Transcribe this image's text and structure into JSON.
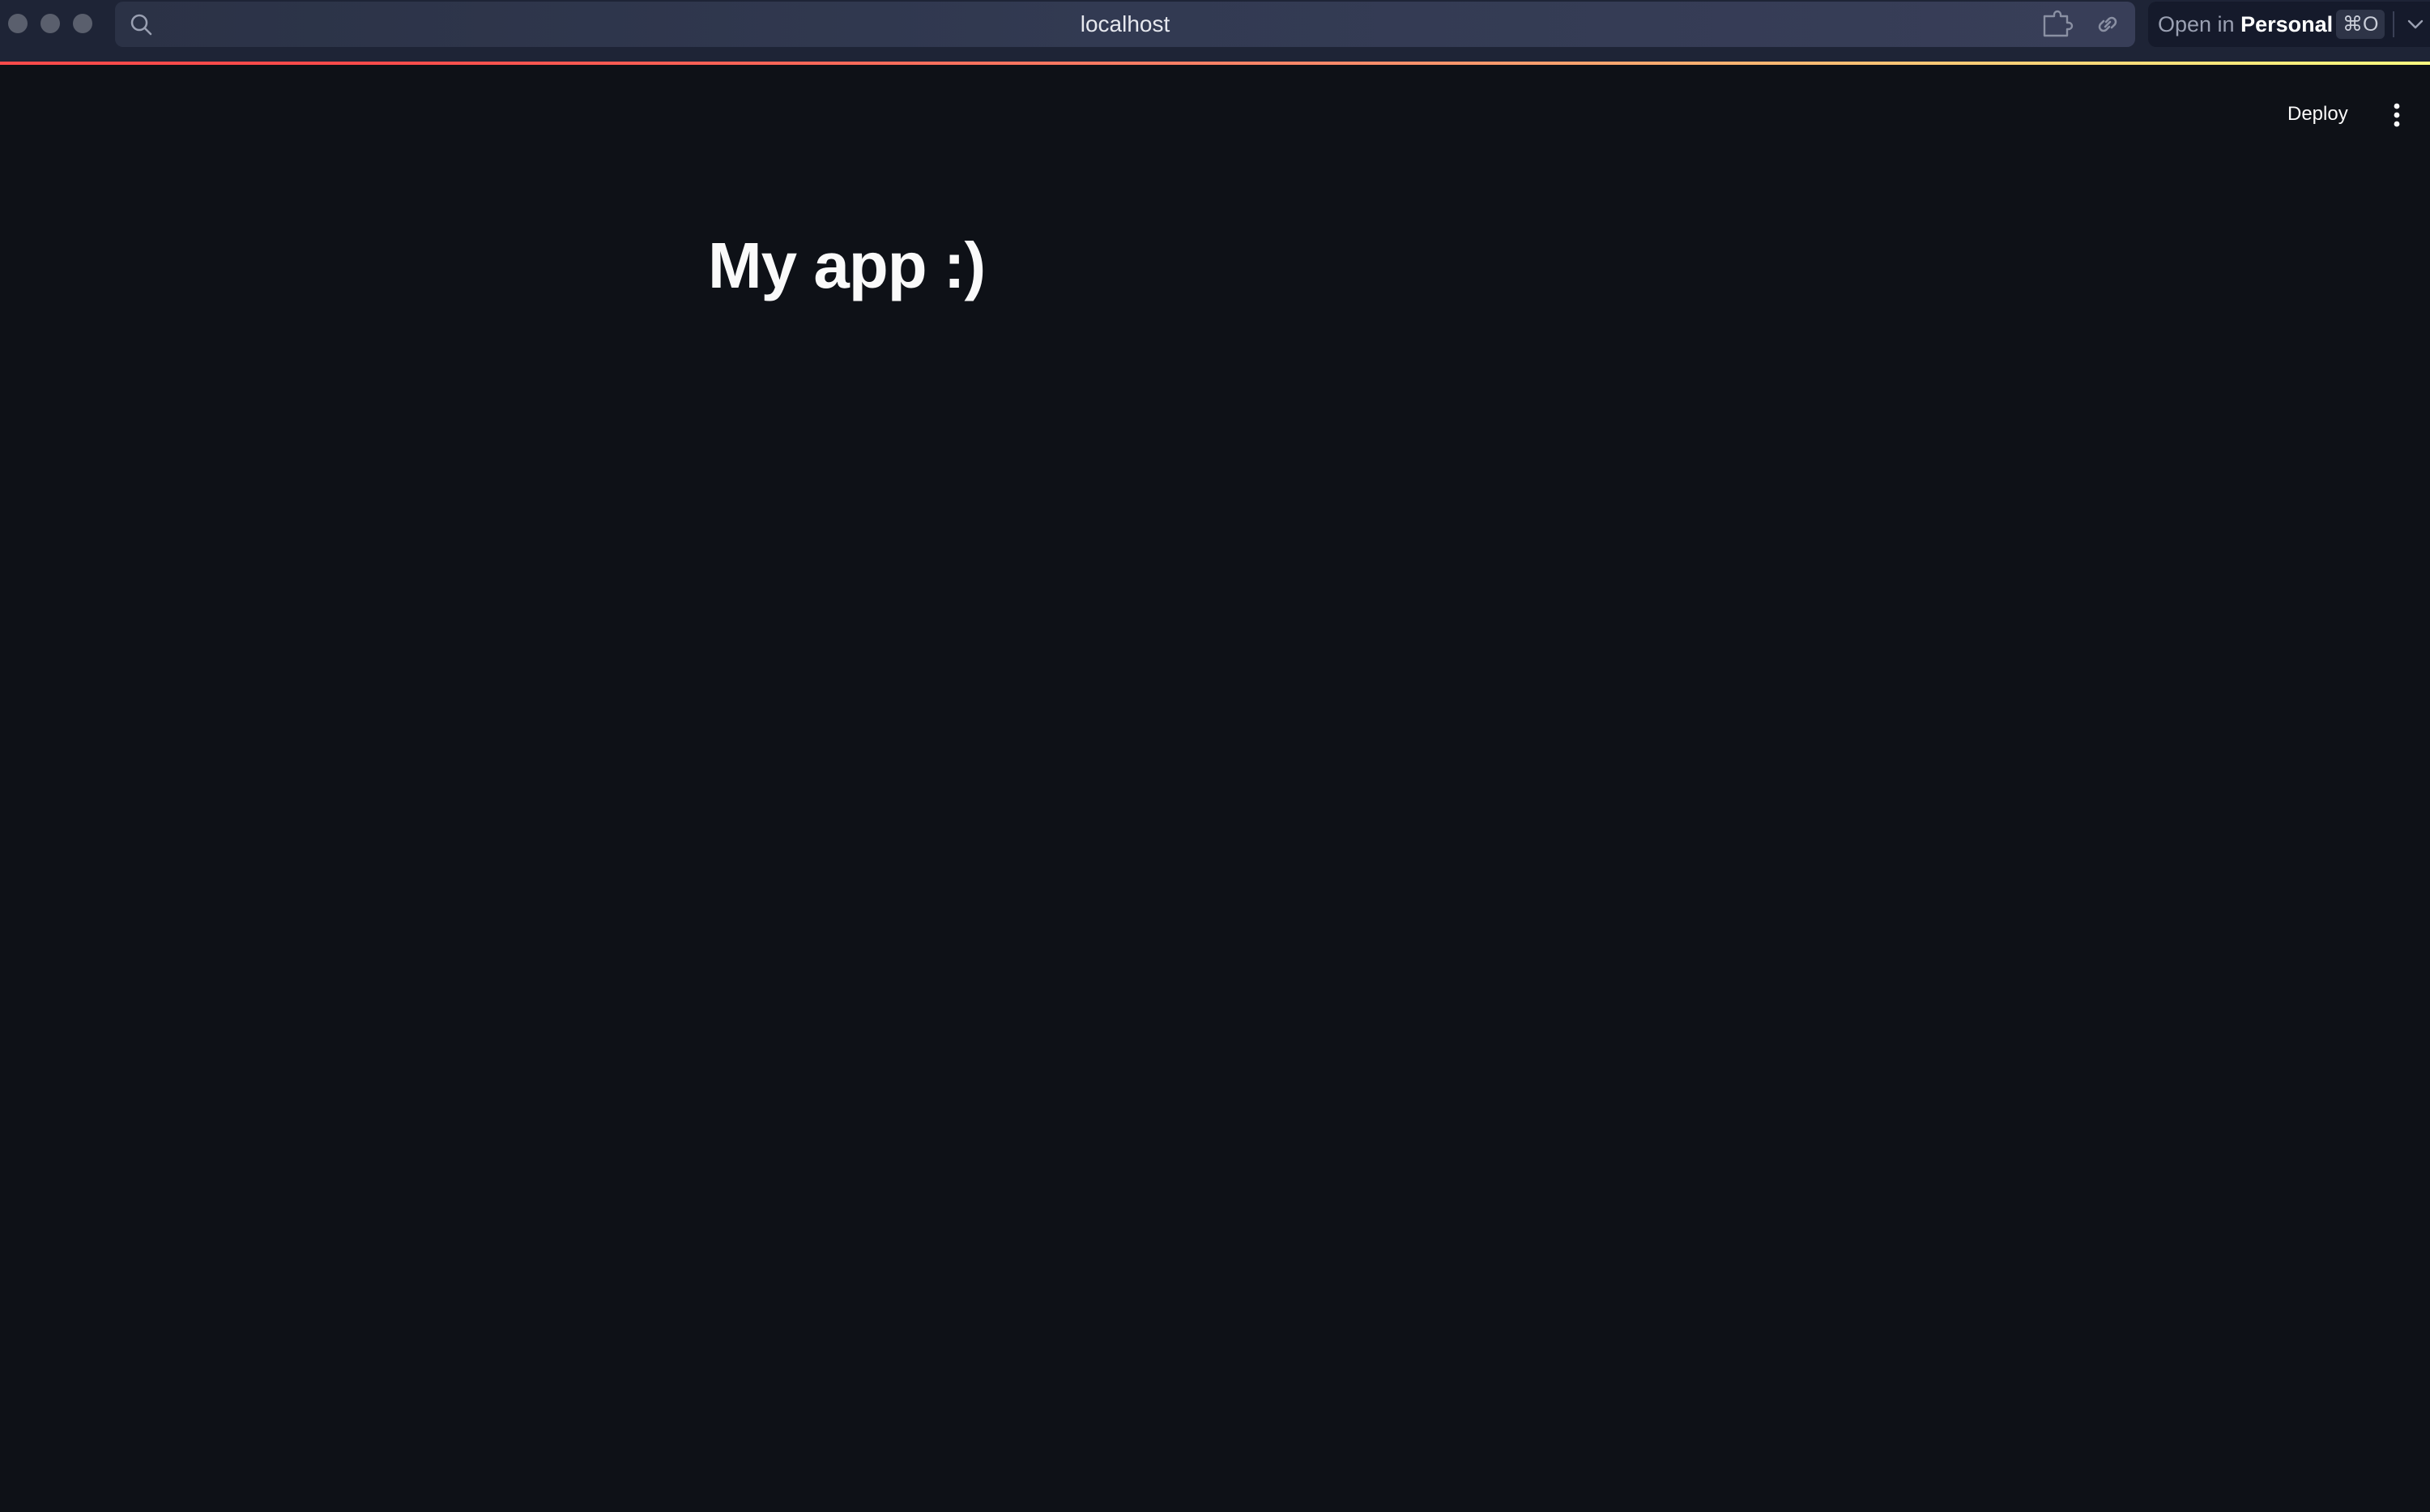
{
  "browser": {
    "url": "localhost",
    "open_in": {
      "prefix": "Open in",
      "profile": "Personal",
      "shortcut": "⌘O"
    },
    "icons": {
      "search": "search-icon",
      "extensions": "puzzle-icon",
      "link": "link-icon",
      "chevron": "chevron-down-icon"
    }
  },
  "app": {
    "header": {
      "deploy_label": "Deploy",
      "menu_icon": "kebab-menu-icon"
    },
    "title": "My app :)"
  },
  "colors": {
    "background": "#0e1117",
    "text": "#fafafa",
    "accent": "#ff4b4b",
    "decoration_end": "#fffd80"
  }
}
